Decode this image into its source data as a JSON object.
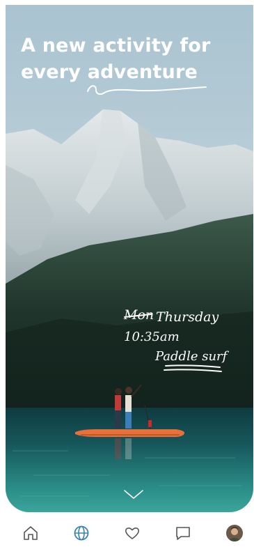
{
  "hero": {
    "headline_line1": "A new activity for",
    "headline_line2": "every adventure",
    "day_crossed": "Mon",
    "day": "Thursday",
    "time": "10:35am",
    "activity": "Paddle surf"
  },
  "nav": {
    "items": [
      {
        "icon": "home-icon",
        "active": false
      },
      {
        "icon": "globe-icon",
        "active": true
      },
      {
        "icon": "heart-icon",
        "active": false
      },
      {
        "icon": "chat-icon",
        "active": false
      },
      {
        "icon": "avatar",
        "active": false
      }
    ],
    "active_color": "#3a83b0",
    "inactive_color": "#555555"
  },
  "colors": {
    "sky": "#b8cdd6",
    "lake": "#1d6a6e",
    "board": "#e8703a"
  }
}
